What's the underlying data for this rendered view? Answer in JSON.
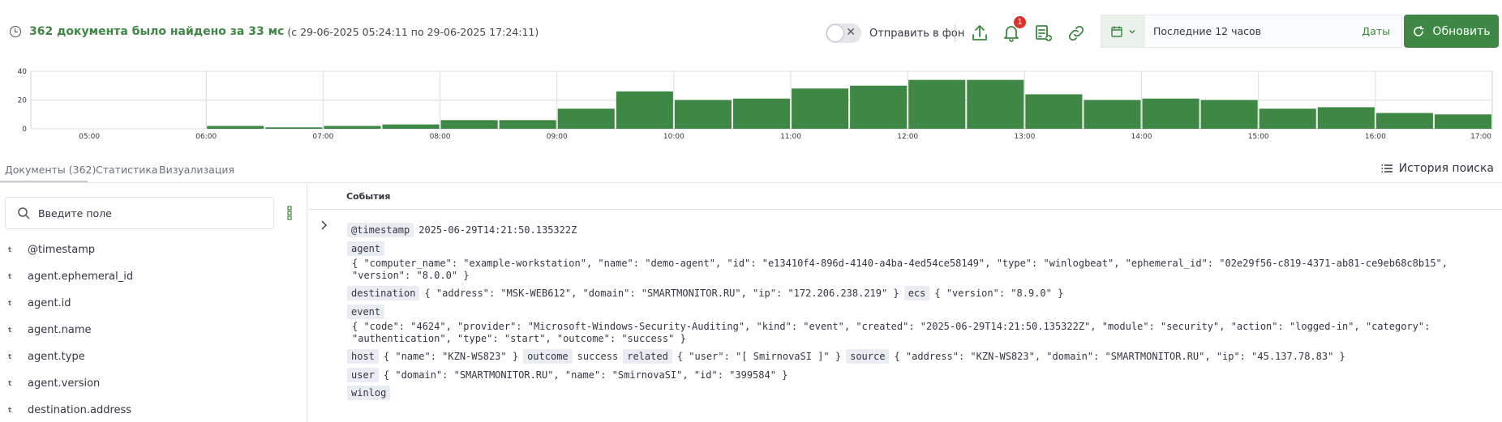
{
  "summary": {
    "count_text": "362 документа было найдено за 33 мс",
    "range_text": "(с 29-06-2025 05:24:11 по 29-06-2025 17:24:11)"
  },
  "toolbar": {
    "background_label": "Отправить в фон",
    "notifications_count": "1",
    "date_range": "Последние 12 часов",
    "dates_link": "Даты",
    "refresh_label": "Обновить"
  },
  "chart_data": {
    "type": "bar",
    "yticks": [
      "40",
      "20",
      "0"
    ],
    "ylim": [
      0,
      40
    ],
    "xticks": [
      "05:00",
      "06:00",
      "07:00",
      "08:00",
      "09:00",
      "10:00",
      "11:00",
      "12:00",
      "13:00",
      "14:00",
      "15:00",
      "16:00",
      "17:00"
    ],
    "values": [
      0,
      0,
      0,
      2,
      1,
      2,
      3,
      6,
      6,
      14,
      26,
      20,
      21,
      28,
      30,
      34,
      34,
      24,
      20,
      21,
      20,
      14,
      15,
      11,
      10
    ],
    "color": "#3e8744"
  },
  "tabs": [
    {
      "label": "Документы (362)"
    },
    {
      "label": "Статистика"
    },
    {
      "label": "Визуализация"
    }
  ],
  "history_label": "История поиска",
  "sidebar": {
    "search_placeholder": "Введите поле",
    "fields": [
      {
        "type": "t",
        "name": "@timestamp"
      },
      {
        "type": "t",
        "name": "agent.ephemeral_id"
      },
      {
        "type": "t",
        "name": "agent.id"
      },
      {
        "type": "t",
        "name": "agent.name"
      },
      {
        "type": "t",
        "name": "agent.type"
      },
      {
        "type": "t",
        "name": "agent.version"
      },
      {
        "type": "t",
        "name": "destination.address"
      }
    ]
  },
  "events": {
    "header": "События",
    "timestamp_key": "@timestamp",
    "timestamp_val": "2025-06-29T14:21:50.135322Z",
    "agent_key": "agent",
    "agent_val": "{ \"computer_name\": \"example-workstation\", \"name\": \"demo-agent\", \"id\": \"e13410f4-896d-4140-a4ba-4ed54ce58149\", \"type\": \"winlogbeat\", \"ephemeral_id\": \"02e29f56-c819-4371-ab81-ce9eb68c8b15\", \"version\": \"8.0.0\" }",
    "destination_key": "destination",
    "destination_val": "{ \"address\": \"MSK-WEB612\", \"domain\": \"SMARTMONITOR.RU\", \"ip\": \"172.206.238.219\" }",
    "ecs_key": "ecs",
    "ecs_val": "{ \"version\": \"8.9.0\" }",
    "event_key": "event",
    "event_val": "{ \"code\": \"4624\", \"provider\": \"Microsoft-Windows-Security-Auditing\", \"kind\": \"event\", \"created\": \"2025-06-29T14:21:50.135322Z\", \"module\": \"security\", \"action\": \"logged-in\", \"category\": \"authentication\", \"type\": \"start\", \"outcome\": \"success\" }",
    "host_key": "host",
    "host_val": "{ \"name\": \"KZN-WS823\" }",
    "outcome_key": "outcome",
    "outcome_val": "success",
    "related_key": "related",
    "related_val": "{ \"user\": \"[ SmirnovaSI ]\" }",
    "source_key": "source",
    "source_val": "{ \"address\": \"KZN-WS823\", \"domain\": \"SMARTMONITOR.RU\", \"ip\": \"45.137.78.83\" }",
    "user_key": "user",
    "user_val": "{ \"domain\": \"SMARTMONITOR.RU\", \"name\": \"SmirnovaSI\", \"id\": \"399584\" }",
    "winlog_key": "winlog"
  }
}
